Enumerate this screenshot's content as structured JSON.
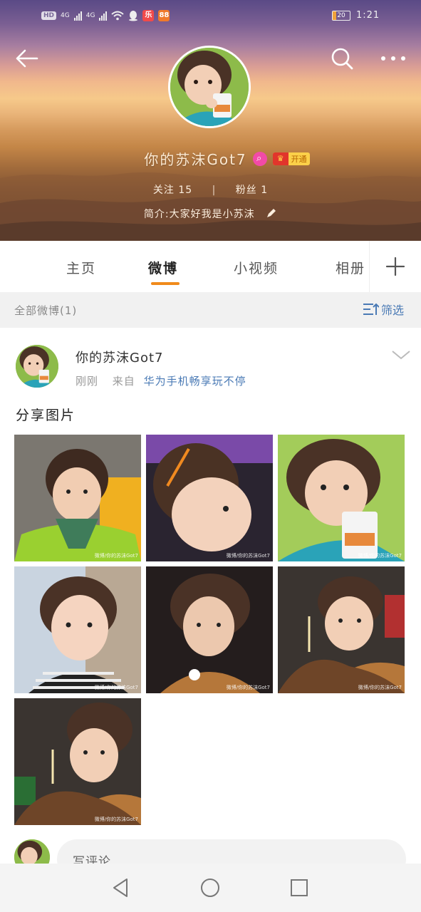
{
  "status": {
    "hd": "HD",
    "net1": "4G",
    "net2": "4G",
    "battery": "20",
    "time": "1:21"
  },
  "profile": {
    "name": "你的苏沫Got7",
    "vip_label": "开通",
    "follow_label": "关注",
    "follow_count": "15",
    "fans_label": "粉丝",
    "fans_count": "1",
    "bio": "简介:大家好我是小苏沫"
  },
  "tabs": [
    {
      "label": "主页"
    },
    {
      "label": "微博"
    },
    {
      "label": "小视频"
    },
    {
      "label": "相册"
    }
  ],
  "filter": {
    "count_text": "全部微博(1)",
    "filter_label": "筛选"
  },
  "post": {
    "author": "你的苏沫Got7",
    "time": "刚刚",
    "from_label": "来自",
    "source": "华为手机畅享玩不停",
    "text": "分享图片",
    "watermark": "微博/你的苏沫Got7"
  },
  "comment": {
    "placeholder": "写评论..."
  },
  "icons": {
    "back": "back-arrow-icon",
    "search": "search-icon",
    "more": "more-dots-icon",
    "edit": "pencil-icon",
    "add": "plus-icon",
    "filter": "filter-icon",
    "chevron": "chevron-down-icon"
  },
  "colors": {
    "accent_orange": "#f08a1b",
    "link_blue": "#4a7ab5",
    "vip_gold": "#fbd049",
    "badge_pink": "#f24aa7"
  }
}
